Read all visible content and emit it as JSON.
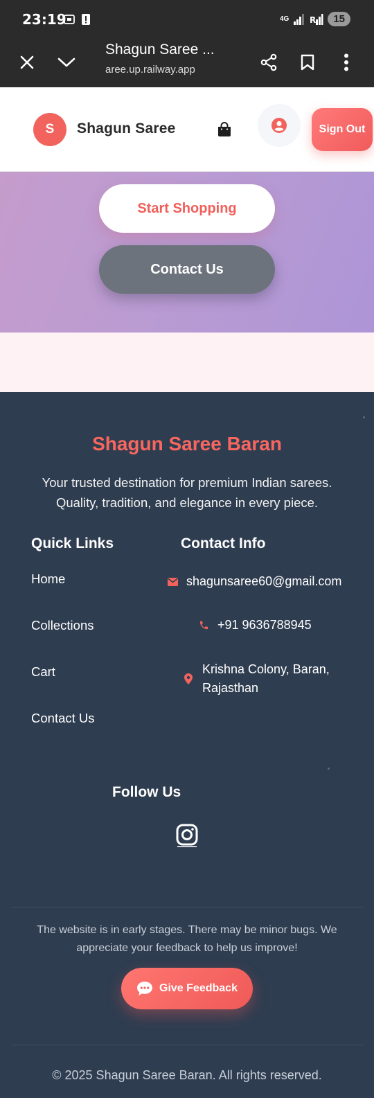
{
  "status_bar": {
    "time": "23:19",
    "network_label": "4G",
    "battery": "15"
  },
  "browser": {
    "tab_title": "Shagun Saree ...",
    "url": "aree.up.railway.app"
  },
  "header": {
    "logo_letter": "S",
    "brand_name": "Shagun Saree",
    "sign_out_label": "Sign Out"
  },
  "hero": {
    "start_shopping_label": "Start Shopping",
    "contact_us_label": "Contact Us"
  },
  "footer": {
    "title": "Shagun Saree Baran",
    "description": "Your trusted destination for premium Indian sarees. Quality, tradition, and elegance in every piece.",
    "quick_links_heading": "Quick Links",
    "quick_links": [
      "Home",
      "Collections",
      "Cart",
      "Contact Us"
    ],
    "contact_info_heading": "Contact Info",
    "contact": {
      "email": "shagunsaree60@gmail.com",
      "phone": "+91 9636788945",
      "address": "Krishna Colony, Baran, Rajasthan"
    },
    "follow_us_heading": "Follow Us",
    "note": "The website is in early stages. There may be minor bugs. We appreciate your feedback to help us improve!",
    "feedback_label": "Give Feedback",
    "copyright": "© 2025 Shagun Saree Baran. All rights reserved."
  },
  "icons": {
    "close": "close-icon",
    "chevron": "chevron-down-icon",
    "share": "share-icon",
    "bookmark": "bookmark-icon",
    "menu": "more-vert-icon",
    "bag": "shopping-bag-icon",
    "user": "user-circle-icon",
    "email": "envelope-icon",
    "phone": "phone-icon",
    "location": "map-pin-icon",
    "instagram": "instagram-icon",
    "feedback": "chat-bubble-icon"
  },
  "colors": {
    "accent": "#f2635d",
    "footer_bg": "#2f3d50",
    "hero_gradient_start": "#c59ccc",
    "hero_gradient_end": "#ad95d6",
    "contact_button": "#6c737c"
  }
}
